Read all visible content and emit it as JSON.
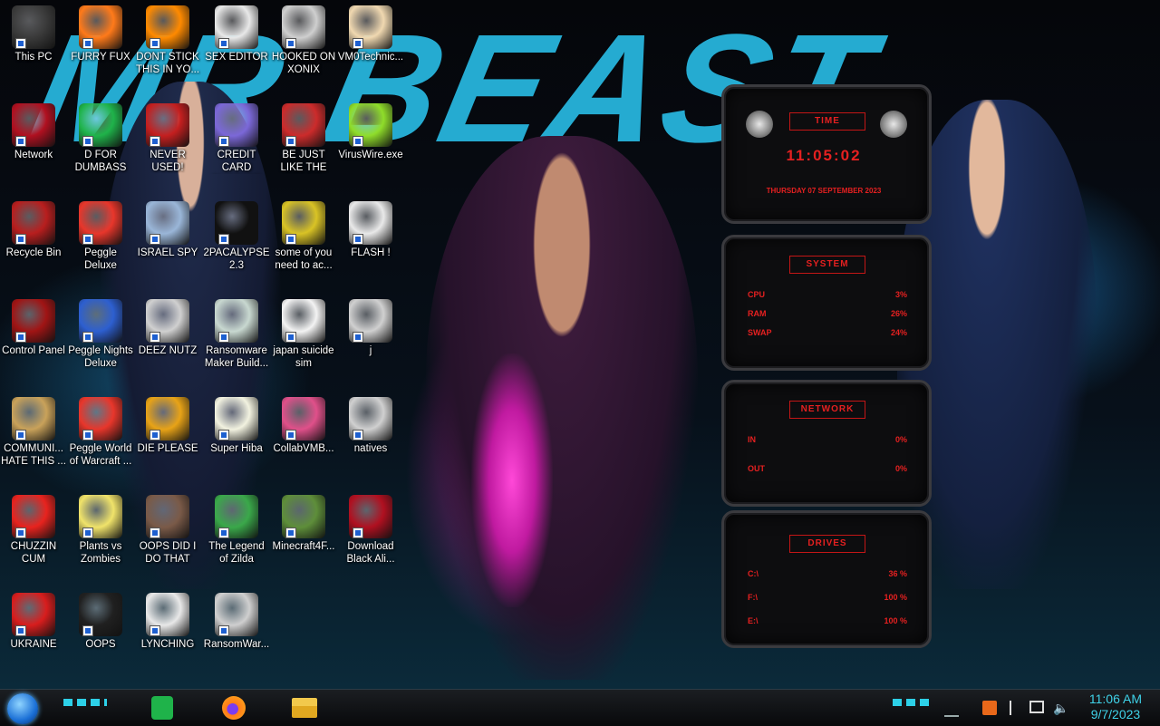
{
  "wallpaper": {
    "title": "MR BEAST"
  },
  "desktop_icons": [
    {
      "label": "This PC",
      "icon": "computer-icon",
      "color": "#3a3a3a"
    },
    {
      "label": "FURRY FUX",
      "icon": "firefox-icon",
      "color": "#ff7a1a"
    },
    {
      "label": "DONT STICK THIS IN YO...",
      "icon": "traffic-cone-icon",
      "color": "#ff8a00"
    },
    {
      "label": "SEX EDITOR",
      "icon": "hex-editor-icon",
      "color": "#e8e8e8"
    },
    {
      "label": "HOOKED ON XONIX",
      "icon": "xonix-icon",
      "color": "#cfcfcf"
    },
    {
      "label": "VM0Technic...",
      "icon": "doctor-icon",
      "color": "#f0d8b0"
    },
    {
      "label": "Network",
      "icon": "alien-network-icon",
      "color": "#b01020"
    },
    {
      "label": "D FOR DUMBASS",
      "icon": "green-doc-icon",
      "color": "#1fb34a"
    },
    {
      "label": "NEVER USED!",
      "icon": "dev-cpp-icon",
      "color": "#c41f1f"
    },
    {
      "label": "CREDIT CARD CHECKER",
      "icon": "credit-card-icon",
      "color": "#7b68d8"
    },
    {
      "label": "BE JUST LIKE THE DUDE!",
      "icon": "santa-icon",
      "color": "#cc2b2b"
    },
    {
      "label": "VirusWire.exe",
      "icon": "lime-icon",
      "color": "#8fdd2a"
    },
    {
      "label": "Recycle Bin",
      "icon": "recycle-bin-icon",
      "color": "#b81e1e"
    },
    {
      "label": "Peggle Deluxe",
      "icon": "peggle-icon",
      "color": "#e8362b"
    },
    {
      "label": "ISRAEL SPY",
      "icon": "monitor-people-icon",
      "color": "#9ab6d8"
    },
    {
      "label": "2PACALYPSE 2.3",
      "icon": "terminal-icon",
      "color": "#111111"
    },
    {
      "label": "some of you need to ac...",
      "icon": "beaver-icon",
      "color": "#d9c325"
    },
    {
      "label": "FLASH !",
      "icon": "flash-file-icon",
      "color": "#e9e9e9"
    },
    {
      "label": "Control Panel",
      "icon": "control-panel-icon",
      "color": "#a01414"
    },
    {
      "label": "Peggle Nights Deluxe",
      "icon": "peggle-nights-icon",
      "color": "#2d5fd0"
    },
    {
      "label": "DEEZ NUTZ",
      "icon": "windows-stack-icon",
      "color": "#d0d0d0"
    },
    {
      "label": "Ransomware Maker Build...",
      "icon": "window-app-icon",
      "color": "#c8d8d0"
    },
    {
      "label": "japan suicide sim",
      "icon": "file-arrows-icon",
      "color": "#f3f3f3"
    },
    {
      "label": "j",
      "icon": "file-icon",
      "color": "#d0d0d0"
    },
    {
      "label": "COMMUNI... HATE THIS ...",
      "icon": "money-bag-icon",
      "color": "#c9a25a"
    },
    {
      "label": "Peggle World of Warcraft ...",
      "icon": "peggle-wow-icon",
      "color": "#e8362b"
    },
    {
      "label": "DIE PLEASE",
      "icon": "de-logo-icon",
      "color": "#e8a317"
    },
    {
      "label": "Super Hiba",
      "icon": "pixel-dog-icon",
      "color": "#f2f2e0"
    },
    {
      "label": "CollabVMB...",
      "icon": "collab-vm-icon",
      "color": "#e0508a"
    },
    {
      "label": "natives",
      "icon": "file-icon",
      "color": "#d0d0d0"
    },
    {
      "label": "CHUZZIN CUM",
      "icon": "chuzzle-icon",
      "color": "#e8231e"
    },
    {
      "label": "Plants vs Zombies",
      "icon": "flower-icon",
      "color": "#f0e36a"
    },
    {
      "label": "OOPS DID I DO THAT",
      "icon": "portrait-icon",
      "color": "#7a5a48"
    },
    {
      "label": "The Legend of Zilda",
      "icon": "pixel-hero-icon",
      "color": "#3aa84a"
    },
    {
      "label": "Minecraft4F...",
      "icon": "grass-block-icon",
      "color": "#5e8e3a"
    },
    {
      "label": "Download Black Ali...",
      "icon": "alien-download-icon",
      "color": "#b01020"
    },
    {
      "label": "UKRAINE",
      "icon": "radiation-icon",
      "color": "#d81d1d"
    },
    {
      "label": "OOPS",
      "icon": "black-phone-icon",
      "color": "#202020"
    },
    {
      "label": "LYNCHING",
      "icon": "rope-icon",
      "color": "#e8e8e8"
    },
    {
      "label": "RansomWar...",
      "icon": "skull-icon",
      "color": "#cfcfcf"
    }
  ],
  "gadget": {
    "time": {
      "header": "TIME",
      "clock": "11:05:02",
      "date": "THURSDAY 07 SEPTEMBER 2023"
    },
    "system": {
      "header": "SYSTEM",
      "rows": [
        {
          "label": "CPU",
          "value": "3%"
        },
        {
          "label": "RAM",
          "value": "26%"
        },
        {
          "label": "SWAP",
          "value": "24%"
        }
      ]
    },
    "network": {
      "header": "NETWORK",
      "rows": [
        {
          "label": "IN",
          "value": "0%"
        },
        {
          "label": "OUT",
          "value": "0%"
        }
      ]
    },
    "drives": {
      "header": "DRIVES",
      "rows": [
        {
          "label": "C:\\",
          "value": "36 %"
        },
        {
          "label": "F:\\",
          "value": "100 %"
        },
        {
          "label": "E:\\",
          "value": "100 %"
        }
      ]
    },
    "accent": "#e52020"
  },
  "taskbar": {
    "pinned": [
      {
        "name": "green-doc-icon",
        "color": "#1fb34a"
      },
      {
        "name": "firefox-icon",
        "color": "#ff7a1a"
      },
      {
        "name": "file-explorer-icon",
        "color": "#f2c94c"
      }
    ],
    "clock": {
      "time": "11:06 AM",
      "date": "9/7/2023"
    },
    "accent": "#3fd2e8"
  }
}
